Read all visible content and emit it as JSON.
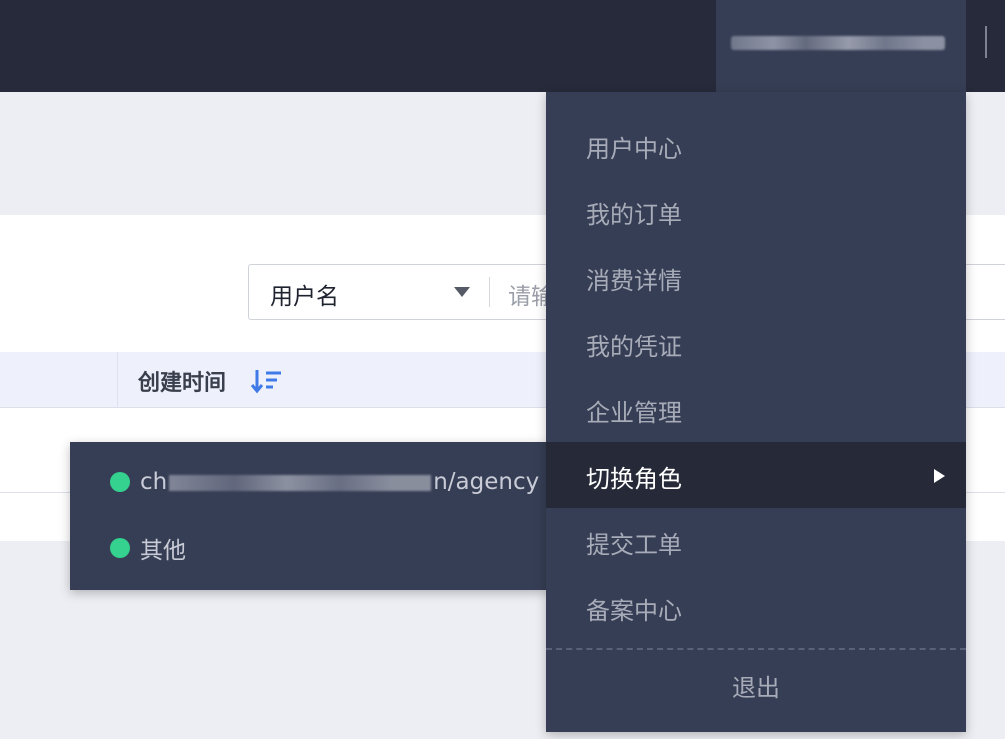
{
  "header": {
    "username_blurred": true
  },
  "filter": {
    "select_label": "用户名",
    "input_placeholder": "请输"
  },
  "table": {
    "columns": [
      {
        "label": "创建时间",
        "sortable": true
      }
    ]
  },
  "user_menu": {
    "items": [
      {
        "label": "用户中心"
      },
      {
        "label": "我的订单"
      },
      {
        "label": "消费详情"
      },
      {
        "label": "我的凭证"
      },
      {
        "label": "企业管理"
      },
      {
        "label": "切换角色",
        "active": true,
        "has_submenu": true
      },
      {
        "label": "提交工单"
      },
      {
        "label": "备案中心"
      }
    ],
    "logout_label": "退出"
  },
  "role_submenu": {
    "items": [
      {
        "prefix": "ch",
        "suffix": "n/agency",
        "status_color": "#34d18f"
      },
      {
        "label": "其他",
        "status_color": "#34d18f"
      }
    ]
  },
  "colors": {
    "topbar": "#262a3a",
    "menu_bg": "#363e55",
    "active_bg": "#262a38",
    "status_green": "#34d18f",
    "sort_blue": "#3f7ae8"
  }
}
